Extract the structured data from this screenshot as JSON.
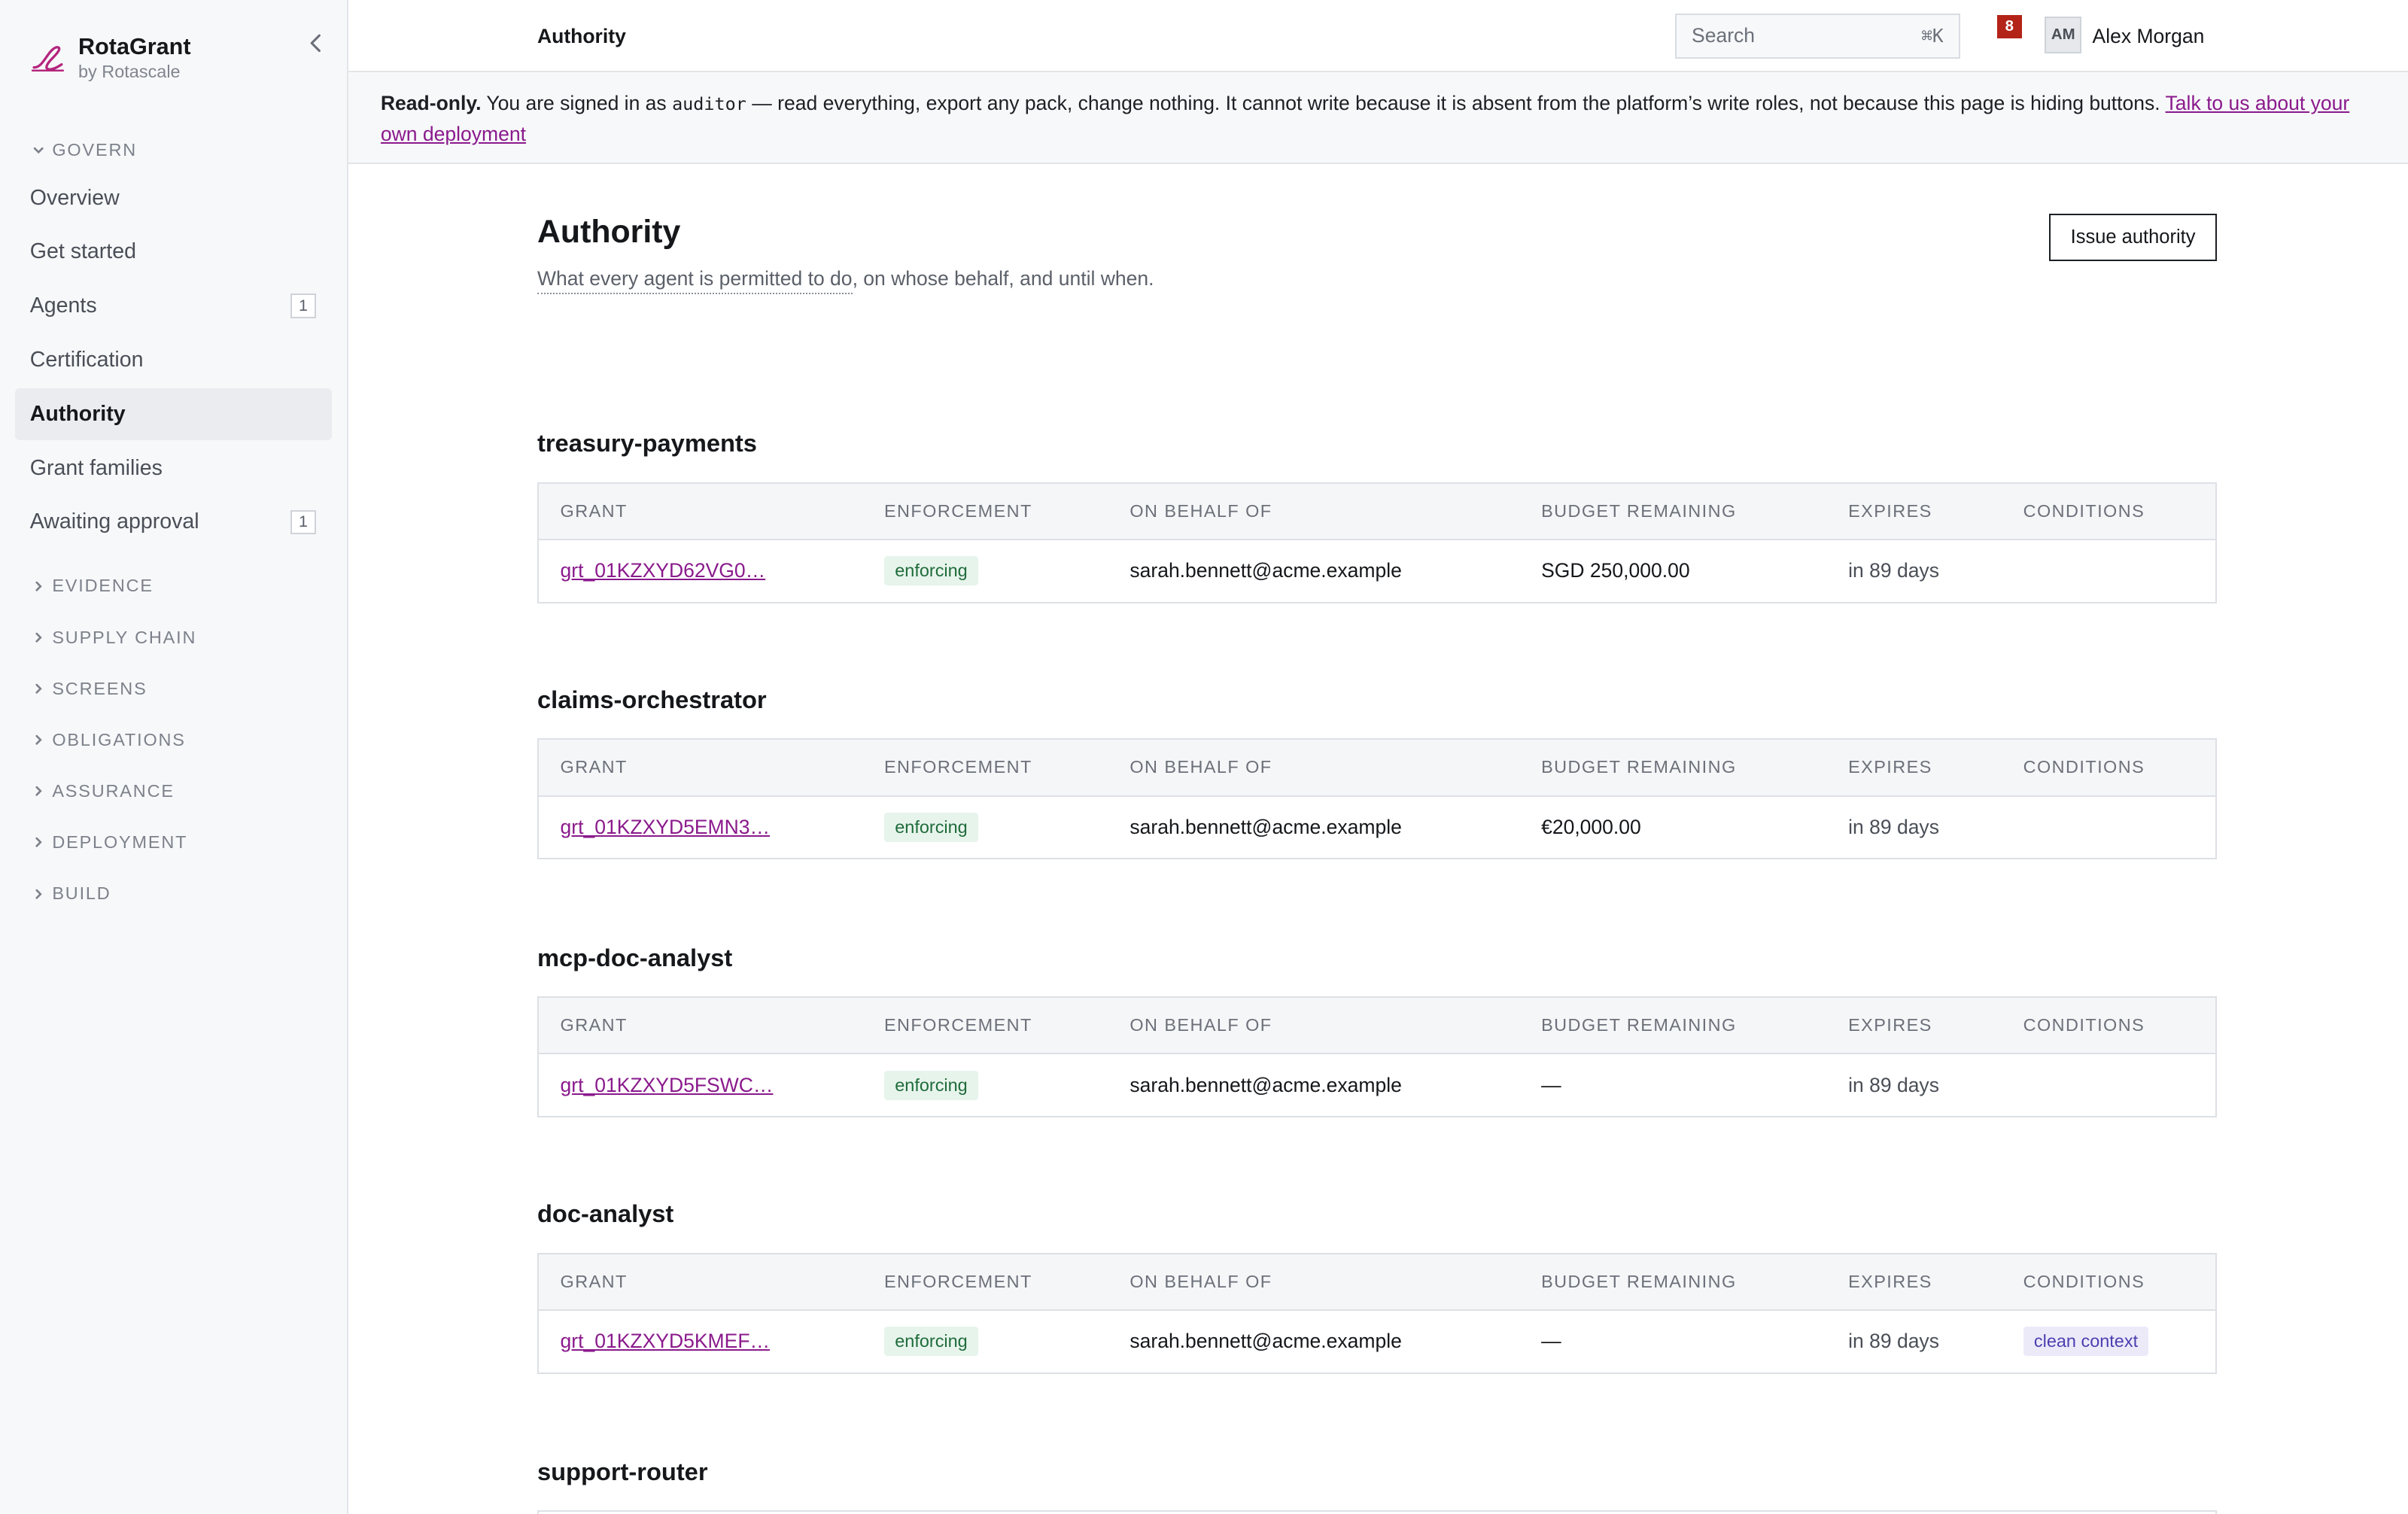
{
  "brand": {
    "name": "RotaGrant",
    "sub": "by Rotascale"
  },
  "sidebar": {
    "govern_label": "GOVERN",
    "items": [
      {
        "label": "Overview"
      },
      {
        "label": "Get started"
      },
      {
        "label": "Agents",
        "count": "1"
      },
      {
        "label": "Certification"
      },
      {
        "label": "Authority"
      },
      {
        "label": "Grant families"
      },
      {
        "label": "Awaiting approval",
        "count": "1"
      }
    ],
    "groups": [
      "EVIDENCE",
      "SUPPLY CHAIN",
      "SCREENS",
      "OBLIGATIONS",
      "ASSURANCE",
      "DEPLOYMENT",
      "BUILD"
    ]
  },
  "topbar": {
    "title": "Authority",
    "search_placeholder": "Search",
    "search_shortcut": "⌘K",
    "notifications": "8",
    "avatar_initials": "AM",
    "user_name": "Alex Morgan"
  },
  "banner": {
    "bold": "Read-only.",
    "pre": " You are signed in as ",
    "role": "auditor",
    "post": " — read everything, export any pack, change nothing. It cannot write because it is absent from the platform’s write roles, not because this page is hiding buttons.  ",
    "link": "Talk to us about your own deployment"
  },
  "page": {
    "title": "Authority",
    "subtitle_underlined": "What every agent is permitted to do",
    "subtitle_rest": ", on whose behalf, and until when.",
    "issue_button": "Issue authority"
  },
  "columns": [
    "GRANT",
    "ENFORCEMENT",
    "ON BEHALF OF",
    "BUDGET REMAINING",
    "EXPIRES",
    "CONDITIONS"
  ],
  "sections": [
    {
      "name": "treasury-payments",
      "grant": "grt_01KZXYD62VG0…",
      "enforcement": "enforcing",
      "on_behalf_of": "sarah.bennett@acme.example",
      "budget": "SGD 250,000.00",
      "expires": "in 89 days",
      "conditions": ""
    },
    {
      "name": "claims-orchestrator",
      "grant": "grt_01KZXYD5EMN3…",
      "enforcement": "enforcing",
      "on_behalf_of": "sarah.bennett@acme.example",
      "budget": "€20,000.00",
      "expires": "in 89 days",
      "conditions": ""
    },
    {
      "name": "mcp-doc-analyst",
      "grant": "grt_01KZXYD5FSWC…",
      "enforcement": "enforcing",
      "on_behalf_of": "sarah.bennett@acme.example",
      "budget": "—",
      "expires": "in 89 days",
      "conditions": ""
    },
    {
      "name": "doc-analyst",
      "grant": "grt_01KZXYD5KMEF…",
      "enforcement": "enforcing",
      "on_behalf_of": "sarah.bennett@acme.example",
      "budget": "—",
      "expires": "in 89 days",
      "conditions": "clean context"
    },
    {
      "name": "support-router"
    }
  ]
}
